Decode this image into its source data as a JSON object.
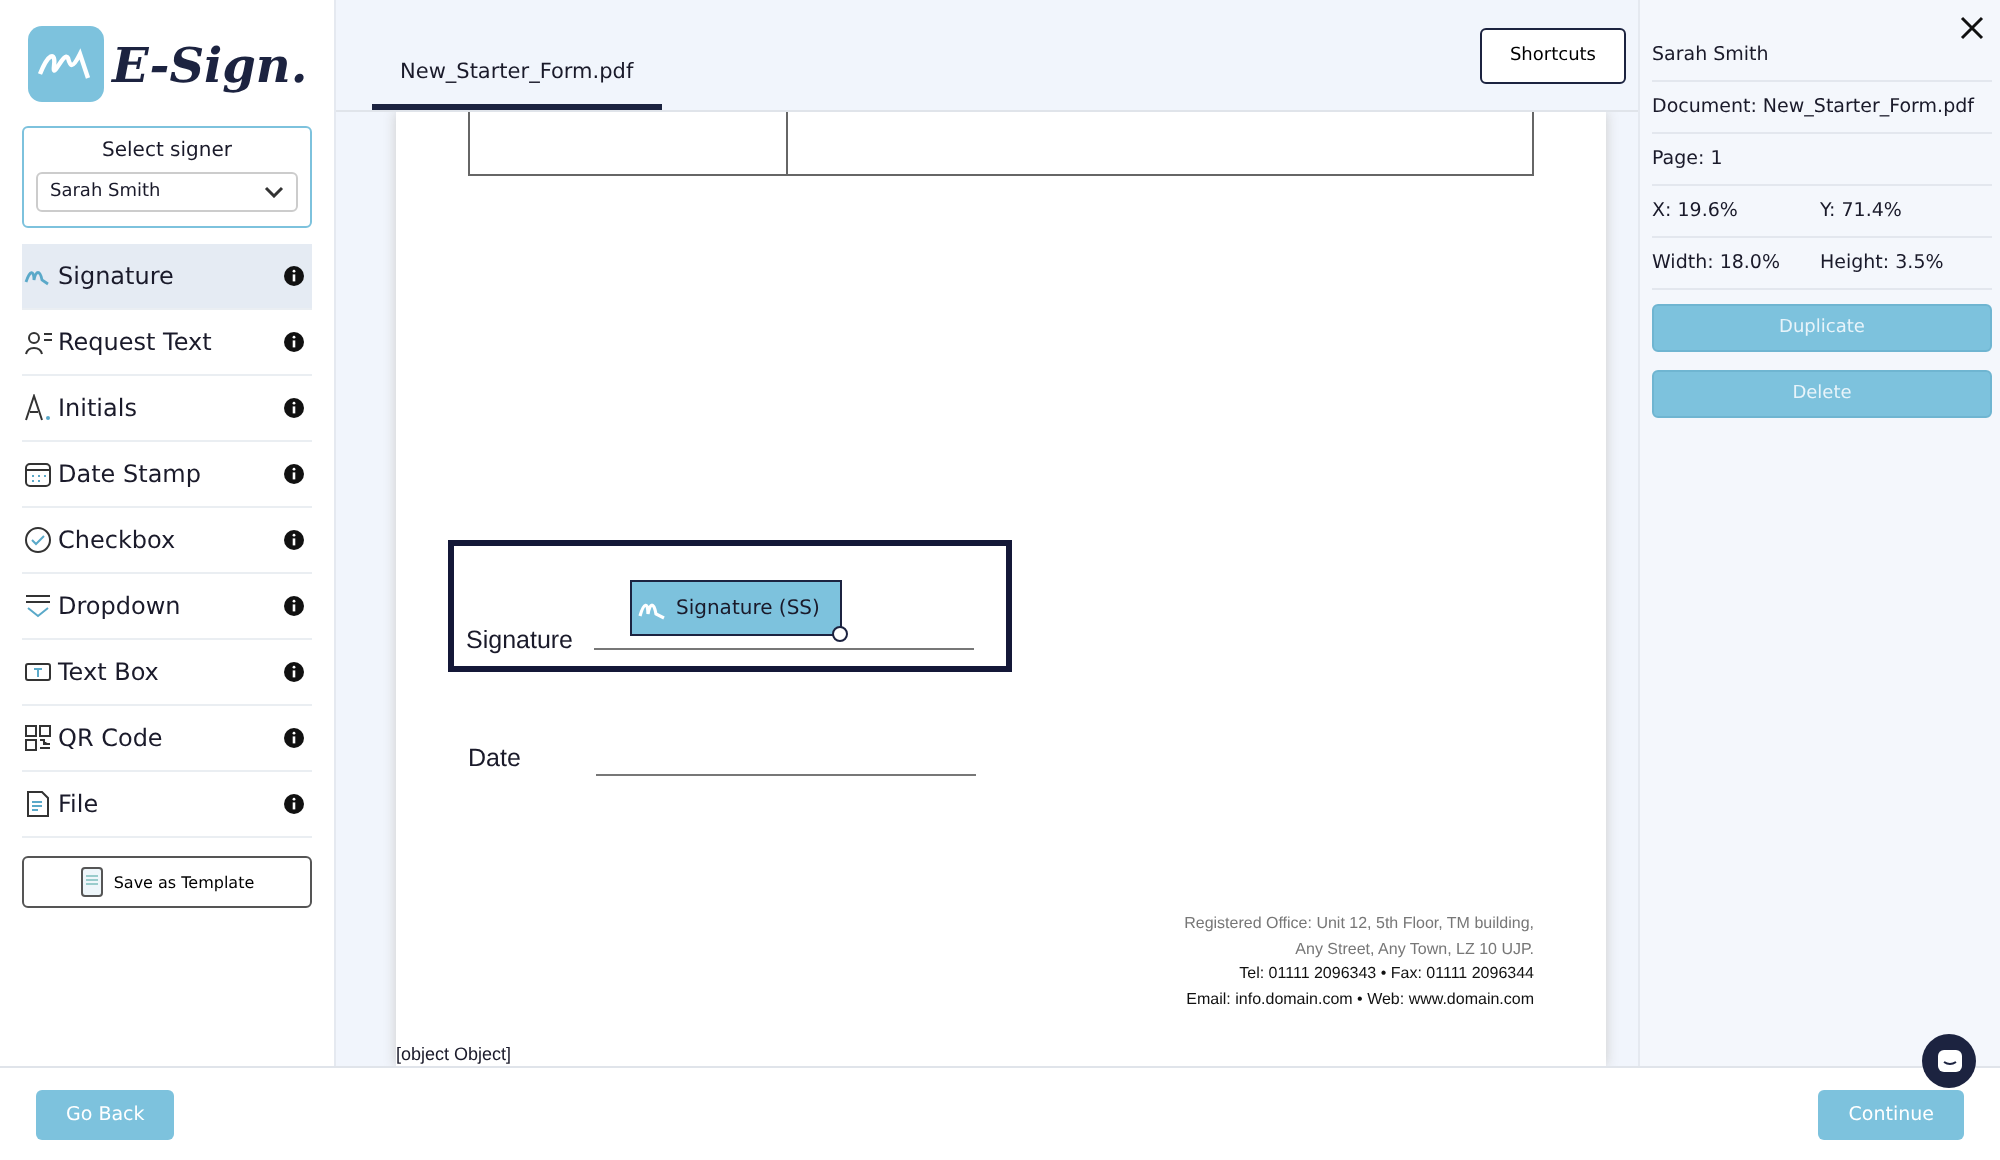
{
  "logo": {
    "text": "E-Sign."
  },
  "signer": {
    "label": "Select signer",
    "value": "Sarah Smith"
  },
  "tools": [
    {
      "label": "Signature",
      "selected": true
    },
    {
      "label": "Request Text",
      "selected": false
    },
    {
      "label": "Initials",
      "selected": false
    },
    {
      "label": "Date Stamp",
      "selected": false
    },
    {
      "label": "Checkbox",
      "selected": false
    },
    {
      "label": "Dropdown",
      "selected": false
    },
    {
      "label": "Text Box",
      "selected": false
    },
    {
      "label": "QR Code",
      "selected": false
    },
    {
      "label": "File",
      "selected": false
    }
  ],
  "save_template": "Save as Template",
  "tabs": [
    {
      "label": "New_Starter_Form.pdf",
      "selected": true
    }
  ],
  "shortcuts": "Shortcuts",
  "document": {
    "signature_label": "Signature",
    "field": "Signature (SS)",
    "date_label": "Date",
    "footer": [
      "Registered Office: Unit 12, 5th Floor, TM building,",
      "Any Street, Any Town, LZ 10 UJP.",
      "Tel: 01111 2096343  •  Fax:  01111 2096344",
      "Email: info.domain.com  •  Web: www.domain.com"
    ],
    "stray": "[object Object]"
  },
  "panel": {
    "name": "Sarah Smith",
    "document": "Document: New_Starter_Form.pdf",
    "page": "Page: 1",
    "x": "X: 19.6%",
    "y": "Y: 71.4%",
    "width": "Width: 18.0%",
    "height": "Height: 3.5%",
    "buttons": [
      "Duplicate",
      "Delete"
    ]
  },
  "footer": {
    "back": "Go Back",
    "next": "Continue"
  }
}
